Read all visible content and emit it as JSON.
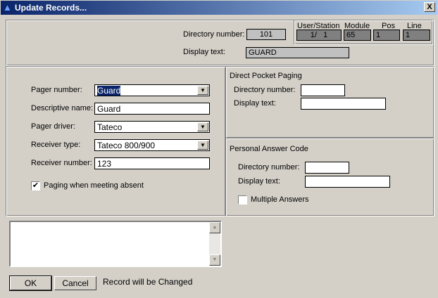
{
  "window": {
    "title": "Update Records...",
    "close": "X"
  },
  "header": {
    "dir_label": "Directory number:",
    "dir_value": "101",
    "disp_label": "Display text:",
    "disp_value": "GUARD",
    "cols": [
      "User/Station",
      "Module",
      "Pos",
      "Line"
    ],
    "vals": [
      "1/   1",
      "65",
      "1",
      "1"
    ]
  },
  "pager": {
    "pager_number_label": "Pager number:",
    "pager_number": "Guard",
    "desc_label": "Descriptive name:",
    "desc": "Guard",
    "driver_label": "Pager driver:",
    "driver": "Tateco",
    "rtype_label": "Receiver type:",
    "rtype": "Tateco 800/900",
    "rnum_label": "Receiver number:",
    "rnum": "123",
    "absent_label": "Paging when meeting absent",
    "absent_checked": true
  },
  "dpp": {
    "title": "Direct Pocket Paging",
    "dir_label": "Directory number:",
    "dir": "",
    "disp_label": "Display text:",
    "disp": ""
  },
  "pac": {
    "title": "Personal Answer Code",
    "dir_label": "Directory number:",
    "dir": "",
    "disp_label": "Display text:",
    "disp": "",
    "multi_label": "Multiple Answers",
    "multi_checked": false
  },
  "footer": {
    "ok": "OK",
    "cancel": "Cancel",
    "status": "Record will be Changed"
  },
  "icons": {
    "check": "✔",
    "arrow": "▼",
    "up": "▲"
  }
}
